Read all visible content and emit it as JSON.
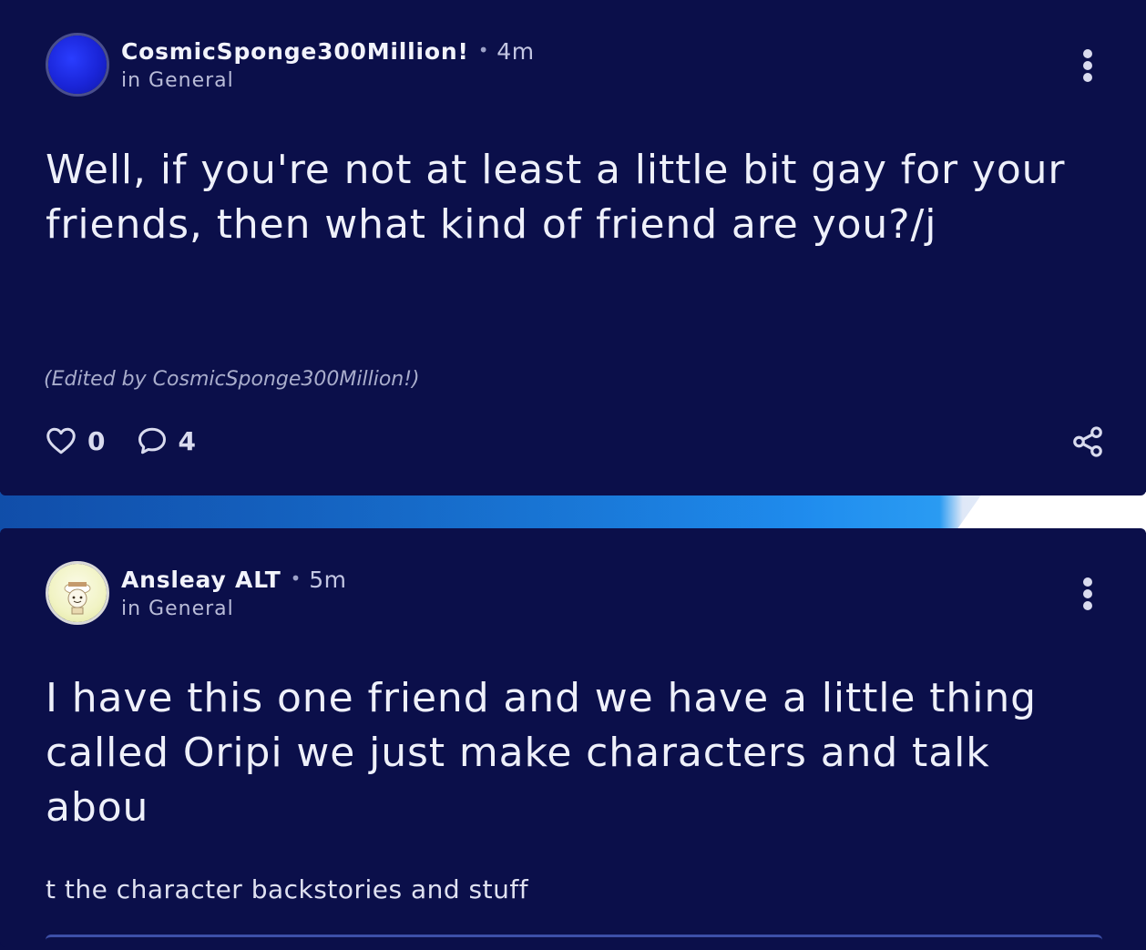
{
  "posts": [
    {
      "author": "CosmicSponge300Million!",
      "time": "4m",
      "location": "in General",
      "body": "Well, if you're not at least a little bit gay for your\nfriends, then what kind of friend are you?/j",
      "edited_note": "(Edited by CosmicSponge300Million!)",
      "likes": "0",
      "comments": "4",
      "avatar_icon": "blue-avatar-icon"
    },
    {
      "author": "Ansleay ALT",
      "time": "5m",
      "location": "in General",
      "body": "I have this one friend and we have a little thing\ncalled Oripi we just make characters and talk\nabou",
      "continuation": "t the character backstories and stuff",
      "avatar_icon": "character-avatar-icon"
    }
  ],
  "separator": "•",
  "colors": {
    "card_bg": "#0b0f4a",
    "text": "#eef0fa",
    "muted": "#b9bcd8",
    "accent_strip": "#1a7fe0"
  },
  "icons": {
    "more": "more-vertical-icon",
    "like": "heart-icon",
    "comment": "comment-bubble-icon",
    "share": "share-icon"
  }
}
